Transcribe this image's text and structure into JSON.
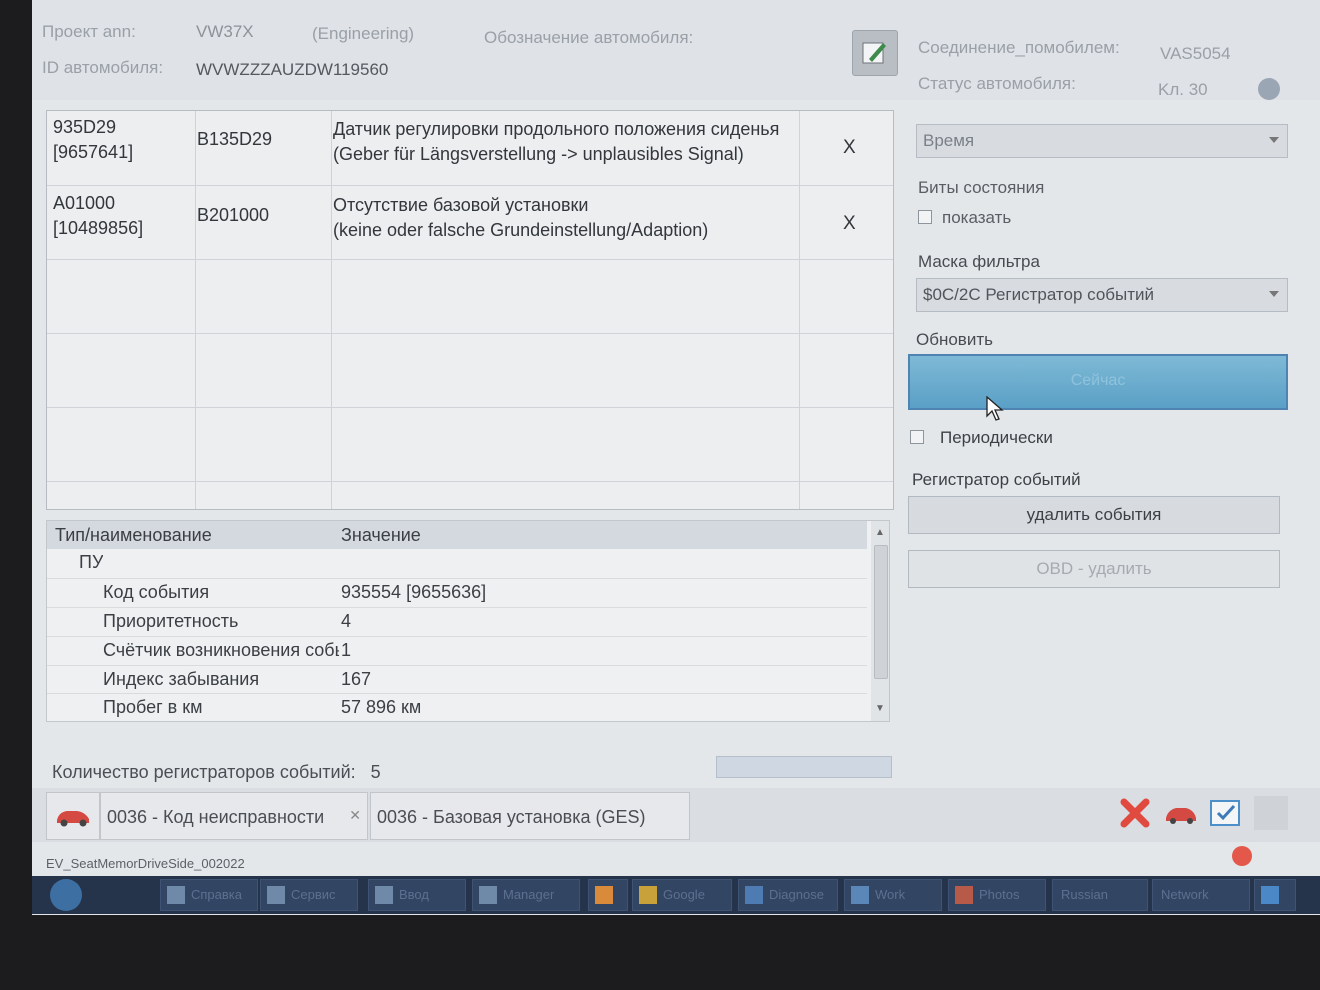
{
  "header": {
    "project_label": "Проект ann:",
    "project_value": "VW37X",
    "project_mode": "(Engineering)",
    "vehicle_designation_label": "Обозначение автомобиля:",
    "vehicle_id_label": "ID автомобиля:",
    "vehicle_id_value": "WVWZZZAUZDW119560",
    "connection_label": "Соединение_помобилем:",
    "connection_value": "VAS5054",
    "vehicle_status_label": "Статус автомобиля:",
    "kl_value": "Kл. 30"
  },
  "faults": [
    {
      "code": "935D29",
      "code_num": "[9657641]",
      "dtc": "B135D29",
      "desc_ru": "Датчик регулировки продольного положения сиденья",
      "desc_de": "(Geber für Längsverstellung -> unplausibles Signal)",
      "mark": "X"
    },
    {
      "code": "A01000",
      "code_num": "[10489856]",
      "dtc": "B201000",
      "desc_ru": "Отсутствие базовой установки",
      "desc_de": "(keine oder falsche Grundeinstellung/Adaption)",
      "mark": "X"
    }
  ],
  "properties": {
    "col_name": "Тип/наименование",
    "col_value": "Значение",
    "group": "ПУ",
    "rows": [
      {
        "name": "Код события",
        "value": "935554 [9655636]"
      },
      {
        "name": "Приоритетность",
        "value": "4"
      },
      {
        "name": "Счётчик возникновения событий",
        "value": "1"
      },
      {
        "name": "Индекс забывания",
        "value": "167"
      },
      {
        "name": "Пробег в км",
        "value": "57 896 км"
      }
    ]
  },
  "event_recorder_count_label": "Количество регистраторов событий:",
  "event_recorder_count": "5",
  "tabs": [
    {
      "label": "0036 - Код неисправности"
    },
    {
      "label": "0036 - Базовая установка (GES)"
    }
  ],
  "status_text": "EV_SeatMemorDriveSide_002022",
  "right_panel": {
    "time_combo": "Время",
    "status_bits_label": "Биты состояния",
    "show_label": "показать",
    "filter_mask_label": "Маска фильтра",
    "filter_mask_value": "$0C/2C Регистратор событий",
    "refresh_label": "Обновить",
    "now_button": "Сейчас",
    "periodic_label": "Периодически",
    "event_recorder_label": "Регистратор событий",
    "delete_events_button": "удалить события",
    "obd_delete_button": "OBD - удалить"
  },
  "taskbar": {
    "items": [
      "Справка",
      "Сервис",
      "Ввод",
      "Manager",
      "",
      "Google",
      "Diagnose",
      "Work",
      "Photos",
      "Russian",
      "Network"
    ]
  },
  "colors": {
    "accent_button": "#5aa0c6",
    "delete_icon": "#e04a3f"
  }
}
